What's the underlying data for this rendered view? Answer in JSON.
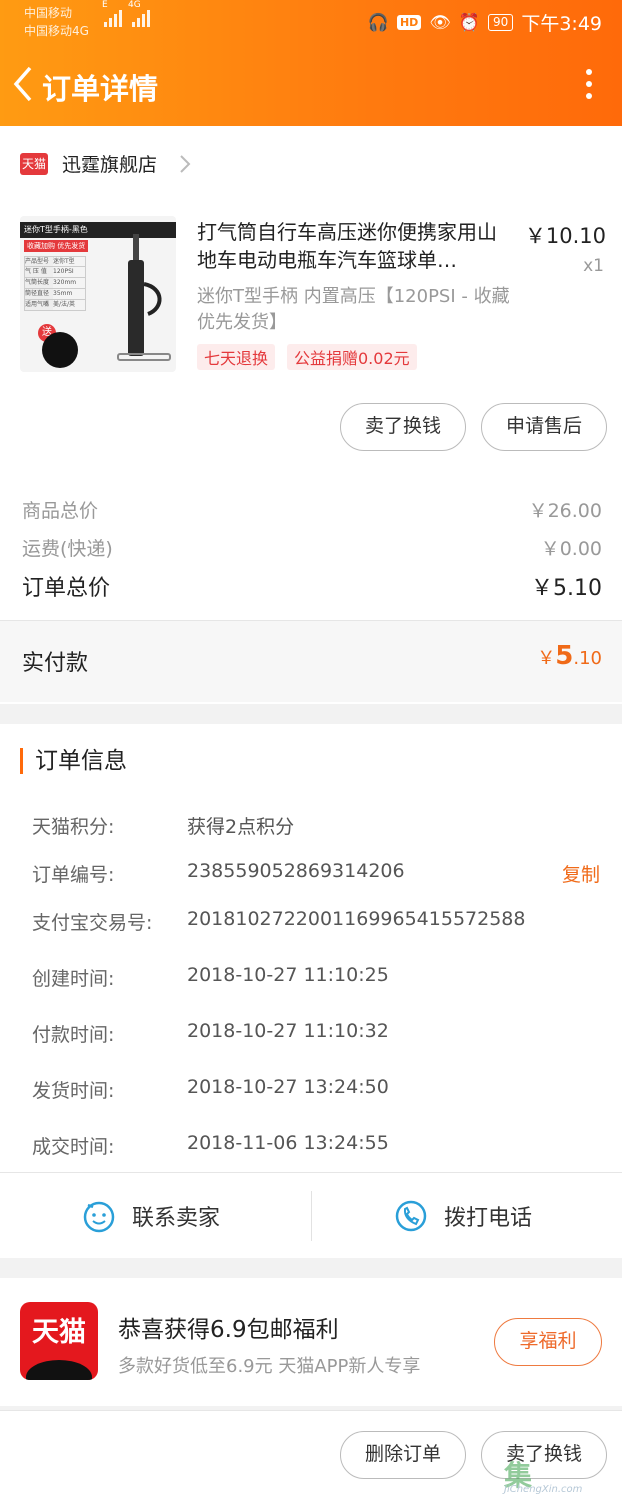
{
  "status": {
    "carrier1": "中国移动",
    "carrier2": "中国移动4G",
    "network_e": "E",
    "network_4g": "4G",
    "battery": "90",
    "time": "下午3:49"
  },
  "header": {
    "title": "订单详情"
  },
  "shop": {
    "badge": "天猫",
    "name": "迅霆旗舰店"
  },
  "product": {
    "title": "打气筒自行车高压迷你便携家用山地车电动电瓶车汽车篮球单…",
    "price": "￥10.10",
    "qty": "x1",
    "sku": "迷你T型手柄 内置高压【120PSI - 收藏优先发货】",
    "tags": [
      "七天退换",
      "公益捐赠0.02元"
    ],
    "image_texts": {
      "banner": "迷你T型手柄-黑色",
      "sub": "收藏加购 优先发货",
      "badge": "送",
      "spec_rows": [
        [
          "产品型号",
          "迷你T型"
        ],
        [
          "气 压 值",
          "120PSI"
        ],
        [
          "气筒长度",
          "320mm"
        ],
        [
          "筒径直径",
          "35mm"
        ],
        [
          "适用气嘴",
          "美/法/英"
        ]
      ]
    }
  },
  "actions": {
    "sell_btn": "卖了换钱",
    "aftersale_btn": "申请售后"
  },
  "summary": {
    "goods_total_label": "商品总价",
    "goods_total": "￥26.00",
    "shipping_label": "运费(快递)",
    "shipping": "￥0.00",
    "order_total_label": "订单总价",
    "order_total": "￥5.10",
    "paid_label": "实付款",
    "paid_currency": "￥",
    "paid_int": "5",
    "paid_dec": ".10"
  },
  "order_info": {
    "title": "订单信息",
    "copy": "复制",
    "rows": [
      {
        "label": "天猫积分:",
        "value": "获得2点积分"
      },
      {
        "label": "订单编号:",
        "value": "238559052869314206"
      },
      {
        "label": "支付宝交易号:",
        "value": "2018102722001169965415572588"
      },
      {
        "label": "创建时间:",
        "value": "2018-10-27 11:10:25"
      },
      {
        "label": "付款时间:",
        "value": "2018-10-27 11:10:32"
      },
      {
        "label": "发货时间:",
        "value": "2018-10-27 13:24:50"
      },
      {
        "label": "成交时间:",
        "value": "2018-11-06 13:24:55"
      }
    ]
  },
  "contact": {
    "seller": "联系卖家",
    "phone": "拨打电话"
  },
  "promo": {
    "logo_text": "天猫",
    "title": "恭喜获得6.9包邮福利",
    "subtitle": "多款好货低至6.9元 天猫APP新人专享",
    "button": "享福利"
  },
  "bottom": {
    "delete_btn": "删除订单",
    "sell_btn": "卖了换钱"
  },
  "watermark": {
    "logo": "集",
    "text": "JiChengXin.com"
  },
  "colors": {
    "accent": "#ff7a0f",
    "price_accent": "#f06a18",
    "tmall_red": "#e4181e"
  }
}
